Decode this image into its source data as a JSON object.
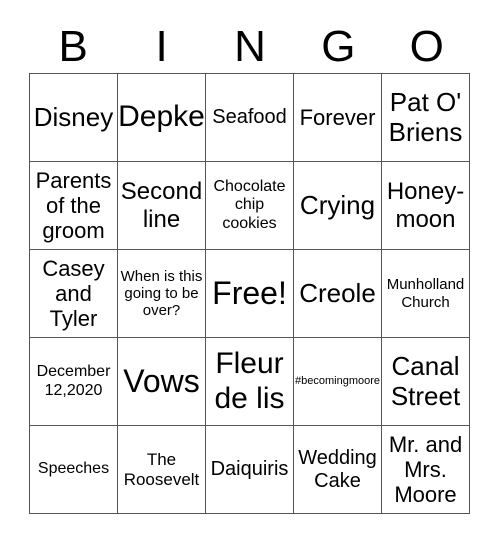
{
  "header": [
    "B",
    "I",
    "N",
    "G",
    "O"
  ],
  "cells": [
    [
      "Disney",
      "Depke",
      "Seafood",
      "Forever",
      "Pat O' Briens"
    ],
    [
      "Parents of the groom",
      "Second line",
      "Chocolate chip cookies",
      "Crying",
      "Honey-moon"
    ],
    [
      "Casey and Tyler",
      "When is this going to be over?",
      "Free!",
      "Creole",
      "Munholland Church"
    ],
    [
      "December 12,2020",
      "Vows",
      "Fleur de lis",
      "#becomingmoore",
      "Canal Street"
    ],
    [
      "Speeches",
      "The Roosevelt",
      "Daiquiris",
      "Wedding Cake",
      "Mr. and Mrs. Moore"
    ]
  ]
}
